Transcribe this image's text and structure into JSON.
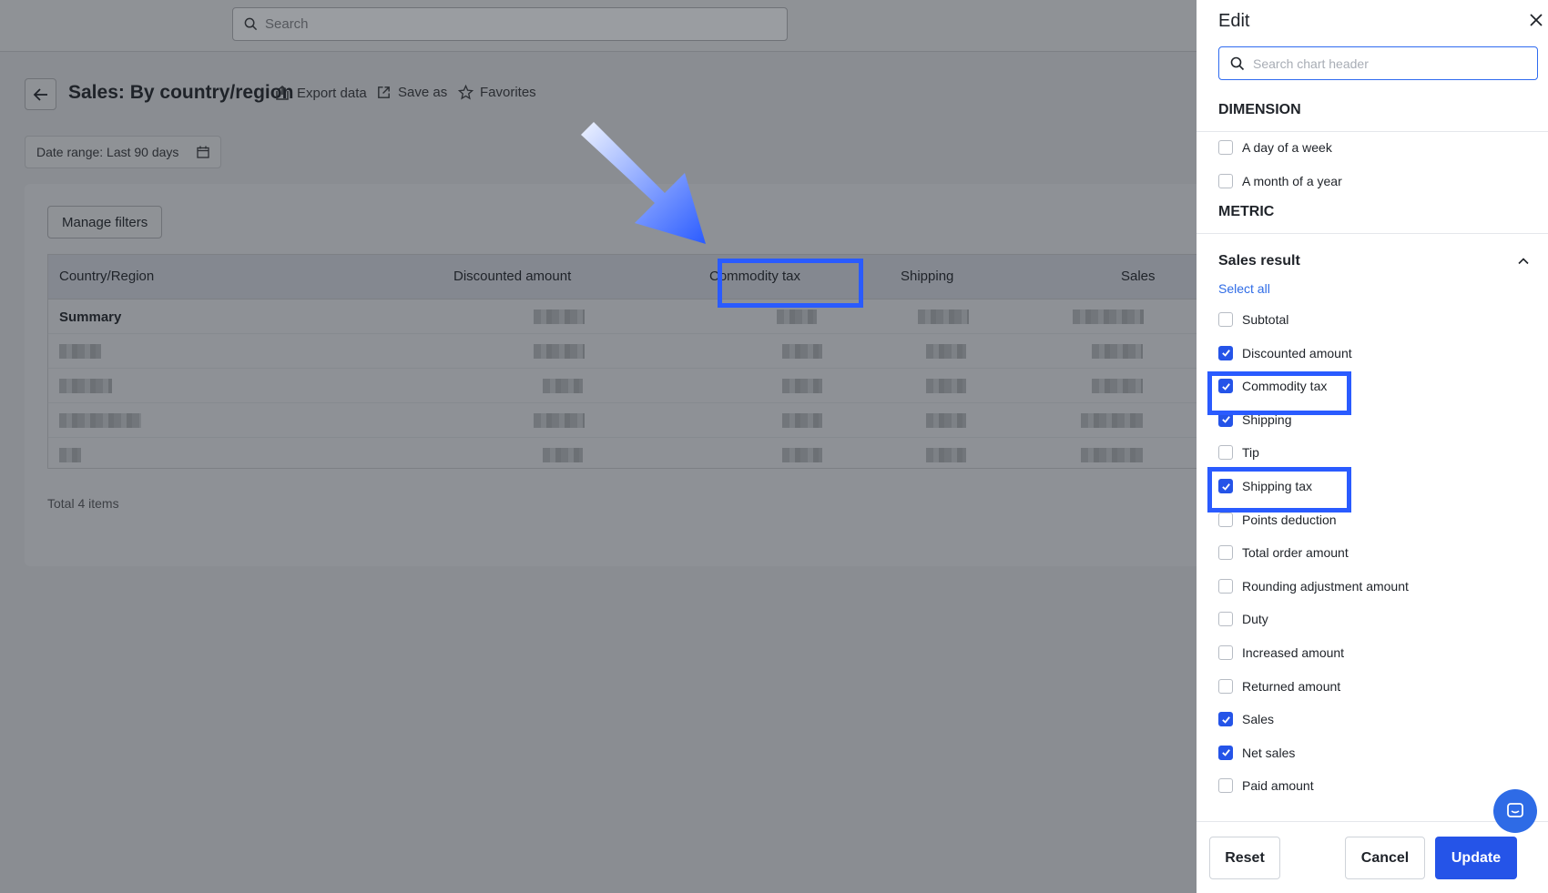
{
  "topbar": {
    "search_placeholder": "Search"
  },
  "header": {
    "title": "Sales: By country/region",
    "actions": {
      "export": "Export data",
      "save_as": "Save as",
      "favorites": "Favorites"
    }
  },
  "filters": {
    "date_range": "Date range: Last 90 days",
    "manage_filters": "Manage filters"
  },
  "table": {
    "columns": [
      "Country/Region",
      "Discounted amount",
      "Commodity tax",
      "Shipping",
      "Sales"
    ],
    "summary_label": "Summary",
    "total": "Total 4 items"
  },
  "panel": {
    "title": "Edit",
    "search_placeholder": "Search chart header",
    "dimension_heading": "DIMENSION",
    "dimension_options": [
      {
        "label": "A day of a week",
        "checked": false
      },
      {
        "label": "A month of a year",
        "checked": false
      }
    ],
    "metric_heading": "METRIC",
    "group_title": "Sales result",
    "select_all": "Select all",
    "metric_options": [
      {
        "label": "Subtotal",
        "checked": false
      },
      {
        "label": "Discounted amount",
        "checked": true
      },
      {
        "label": "Commodity tax",
        "checked": true
      },
      {
        "label": "Shipping",
        "checked": true
      },
      {
        "label": "Tip",
        "checked": false
      },
      {
        "label": "Shipping tax",
        "checked": true
      },
      {
        "label": "Points deduction",
        "checked": false
      },
      {
        "label": "Total order amount",
        "checked": false
      },
      {
        "label": "Rounding adjustment amount",
        "checked": false
      },
      {
        "label": "Duty",
        "checked": false
      },
      {
        "label": "Increased amount",
        "checked": false
      },
      {
        "label": "Returned amount",
        "checked": false
      },
      {
        "label": "Sales",
        "checked": true
      },
      {
        "label": "Net sales",
        "checked": true
      },
      {
        "label": "Paid amount",
        "checked": false
      }
    ],
    "buttons": {
      "reset": "Reset",
      "cancel": "Cancel",
      "update": "Update"
    }
  },
  "colors": {
    "accent": "#2554e8",
    "highlight": "#2a5bff",
    "overlay": "#8a8d92"
  }
}
